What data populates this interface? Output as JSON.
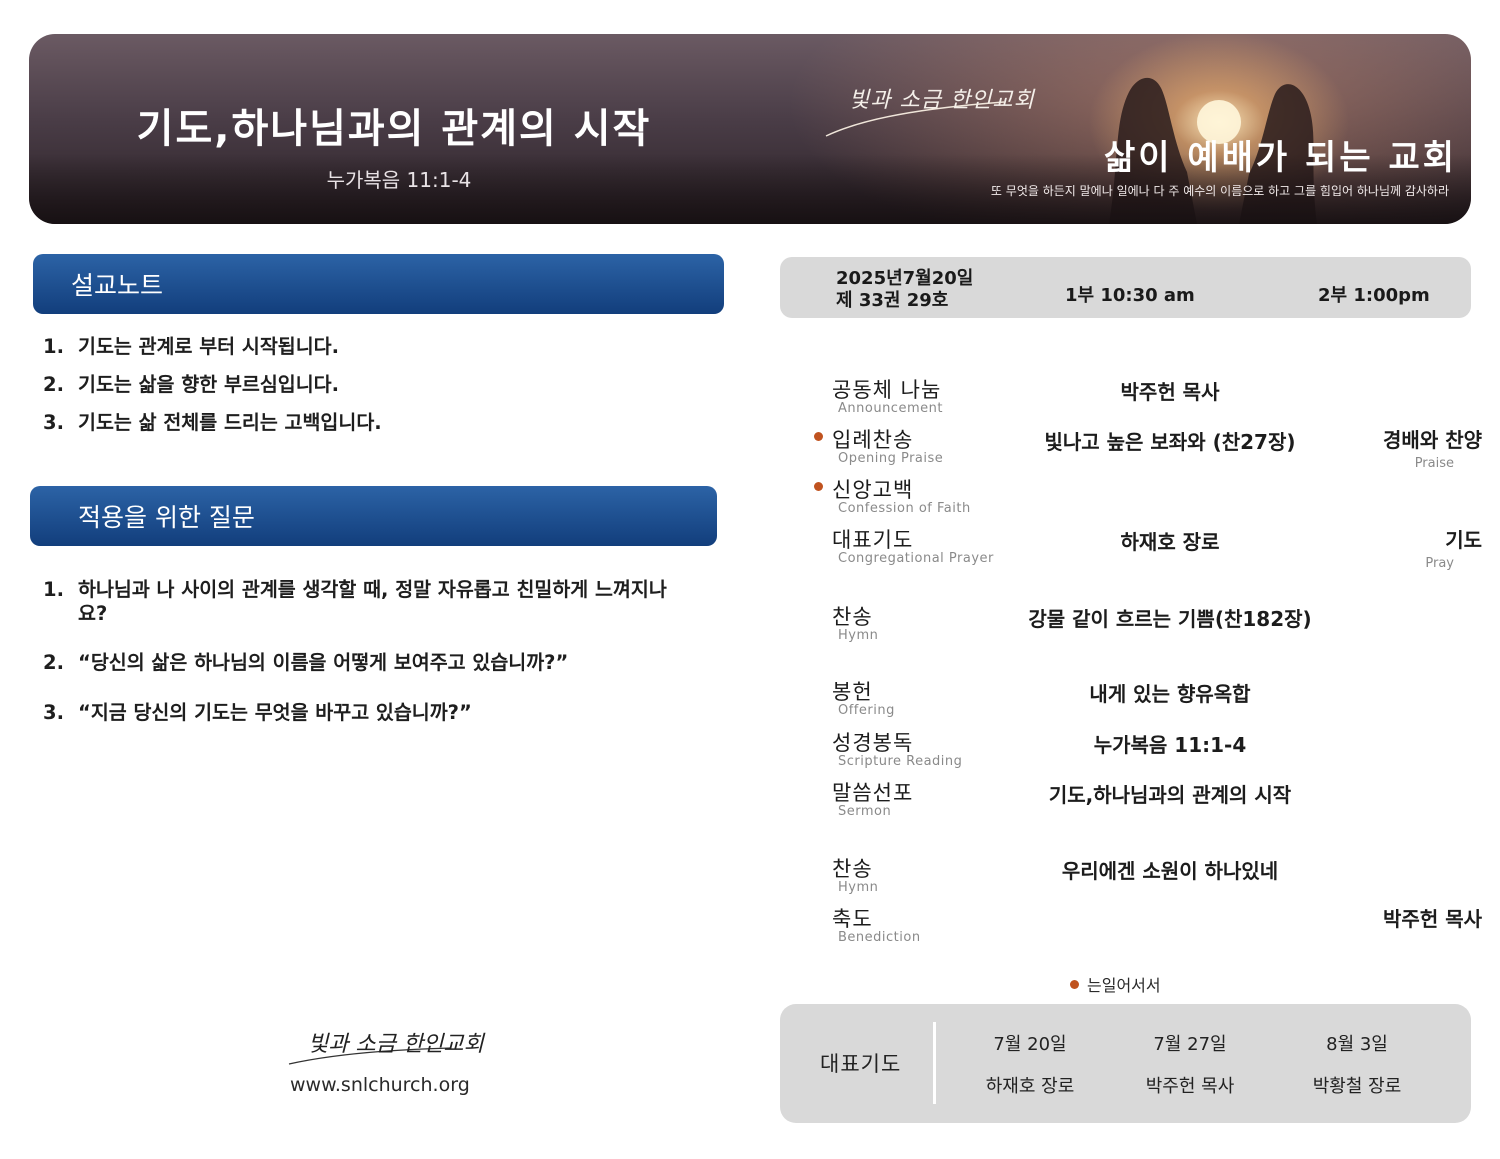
{
  "banner": {
    "title": "기도,하나님과의 관계의 시작",
    "scripture": "누가복음 11:1-4",
    "logo_text": "빛과 소금 한인교회",
    "motto": "삶이 예배가 되는 교회",
    "verse": "또 무엇을 하든지 말에나 일에나 다 주 예수의 이름으로 하고 그를 힘입어 하나님께 감사하라"
  },
  "sermon_notes": {
    "heading": "설교노트",
    "items": [
      {
        "num": "1.",
        "text": "기도는 관계로 부터 시작됩니다."
      },
      {
        "num": "2.",
        "text": "기도는 삶을 향한 부르심입니다."
      },
      {
        "num": "3.",
        "text": "기도는 삶 전체를 드리는 고백입니다."
      }
    ]
  },
  "application": {
    "heading": "적용을 위한 질문",
    "items": [
      {
        "num": "1.",
        "text": "하나님과 나 사이의 관계를 생각할 때, 정말 자유롭고 친밀하게 느껴지나요?"
      },
      {
        "num": "2.",
        "text": "“당신의 삶은 하나님의 이름을 어떻게 보여주고 있습니까?”"
      },
      {
        "num": "3.",
        "text": "“지금 당신의 기도는 무엇을 바꾸고 있습니까?”"
      }
    ]
  },
  "footer": {
    "logo_text": "빛과 소금 한인교회",
    "url": "www.snlchurch.org"
  },
  "info": {
    "date": "2025년7월20일",
    "volume": "제 33권 29호",
    "service1": "1부 10:30 am",
    "service2": "2부 1:00pm"
  },
  "order": [
    {
      "ko": "공동체 나눔",
      "en": "Announcement",
      "standing": false,
      "mid": "박주헌 목사",
      "right": "",
      "right_en": ""
    },
    {
      "ko": "입례찬송",
      "en": "Opening Praise",
      "standing": true,
      "mid": "빛나고 높은 보좌와 (찬27장)",
      "right": "경배와 찬양",
      "right_en": "Praise"
    },
    {
      "ko": "신앙고백",
      "en": "Confession of Faith",
      "standing": true,
      "mid": "",
      "right": "",
      "right_en": ""
    },
    {
      "ko": "대표기도",
      "en": "Congregational Prayer",
      "standing": false,
      "mid": "하재호 장로",
      "right": "기도",
      "right_en": "Pray"
    },
    {
      "ko": "찬송",
      "en": "Hymn",
      "standing": false,
      "mid": "강물 같이 흐르는 기쁨(찬182장)",
      "right": "",
      "right_en": ""
    },
    {
      "ko": "봉헌",
      "en": "Offering",
      "standing": false,
      "mid": "내게 있는 향유옥합",
      "right": "",
      "right_en": ""
    },
    {
      "ko": "성경봉독",
      "en": "Scripture Reading",
      "standing": false,
      "mid": "누가복음 11:1-4",
      "right": "",
      "right_en": ""
    },
    {
      "ko": "말씀선포",
      "en": "Sermon",
      "standing": false,
      "mid": "기도,하나님과의 관계의 시작",
      "right": "",
      "right_en": ""
    },
    {
      "ko": "찬송",
      "en": "Hymn",
      "standing": false,
      "mid": "우리에겐 소원이 하나있네",
      "right": "",
      "right_en": ""
    },
    {
      "ko": "축도",
      "en": "Benediction",
      "standing": false,
      "mid": "",
      "right": "박주헌 목사",
      "right_en": ""
    }
  ],
  "standing_note": "는일어서서",
  "prayer_rota": {
    "title": "대표기도",
    "entries": [
      {
        "date": "7월 20일",
        "name": "하재호 장로"
      },
      {
        "date": "7월 27일",
        "name": "박주헌 목사"
      },
      {
        "date": "8월 3일",
        "name": "박황철 장로"
      }
    ]
  },
  "colors": {
    "section_header": "#1a4d8f",
    "accent_dot": "#c0531f",
    "panel_gray": "#d9d9d9"
  }
}
